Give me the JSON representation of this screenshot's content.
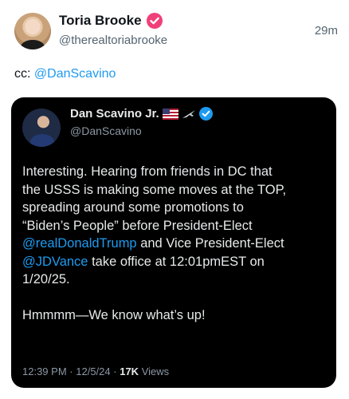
{
  "outer_post": {
    "author_name": "Toria Brooke",
    "handle": "@therealtoriabrooke",
    "time_ago": "29m",
    "cc_prefix": "cc:",
    "cc_mention": "@DanScavino",
    "verified_color": "#f0407a"
  },
  "quoted_post": {
    "author_name": "Dan Scavino Jr.",
    "handle": "@DanScavino",
    "name_icons": [
      "us-flag-icon",
      "jet-icon",
      "verified-icon"
    ],
    "verified_color": "#1d9bf0",
    "line1": "Interesting. Hearing from friends in DC that",
    "line2": "the USSS is making some moves at the TOP,",
    "line3": "spreading around some promotions to",
    "line4": "“Biden’s People” before President-Elect",
    "mention_trump": "@realDonaldTrump",
    "line5_rest": " and Vice President-Elect",
    "mention_vance": "@JDVance",
    "line6_rest": " take office at 12:01pmEST on",
    "line7": "1/20/25.",
    "line8": "Hmmmm—We know what’s up!",
    "time": "12:39 PM",
    "date": "12/5/24",
    "views_count": "17K",
    "views_label": "Views",
    "separator": "·"
  },
  "colors": {
    "link": "#1d9bf0",
    "card_bg": "#000000",
    "text_dark": "#0f1419",
    "secondary": "#536471"
  }
}
